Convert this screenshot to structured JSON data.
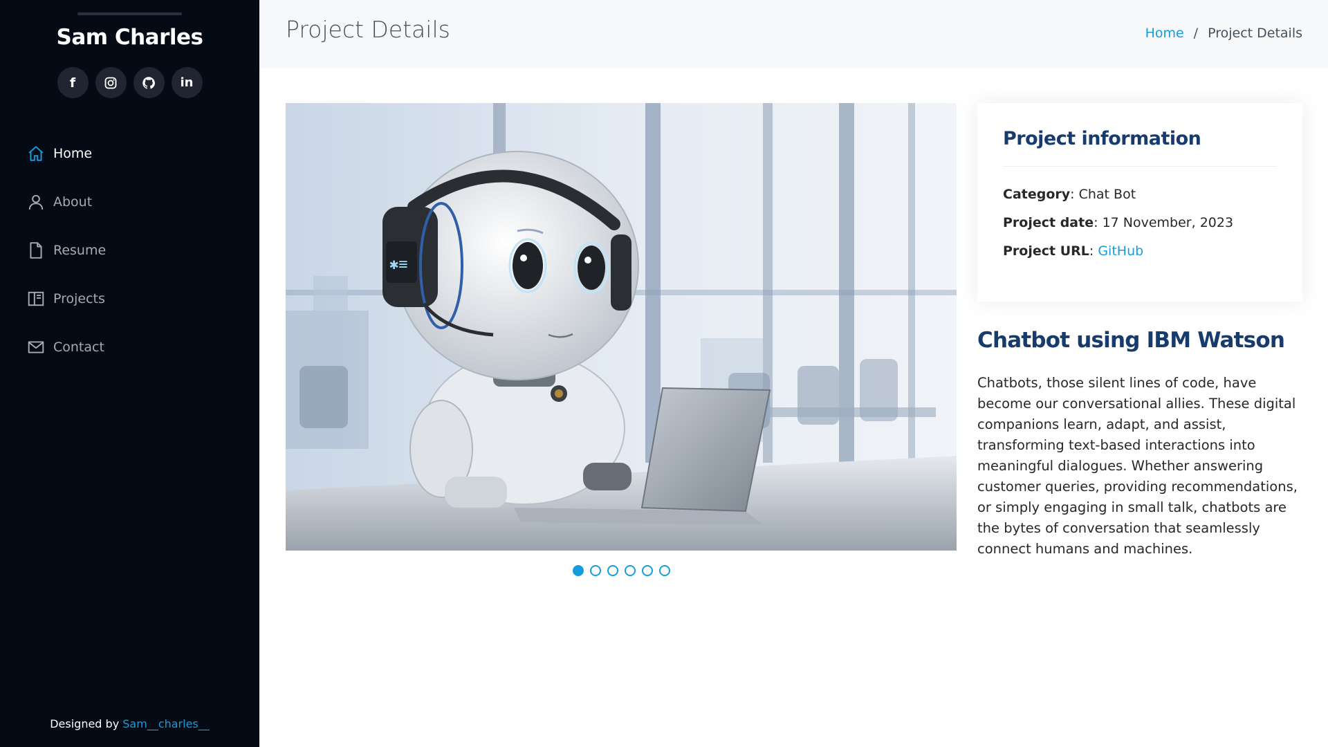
{
  "sidebar": {
    "profile_name": "Sam Charles",
    "social": [
      {
        "name": "facebook-icon",
        "glyph": "f"
      },
      {
        "name": "instagram-icon",
        "glyph": ""
      },
      {
        "name": "github-icon",
        "glyph": ""
      },
      {
        "name": "linkedin-icon",
        "glyph": "in"
      }
    ],
    "nav": [
      {
        "label": "Home",
        "icon": "home-icon",
        "active": true
      },
      {
        "label": "About",
        "icon": "person-icon",
        "active": false
      },
      {
        "label": "Resume",
        "icon": "file-icon",
        "active": false
      },
      {
        "label": "Projects",
        "icon": "book-icon",
        "active": false
      },
      {
        "label": "Contact",
        "icon": "envelope-icon",
        "active": false
      }
    ],
    "footer": {
      "prefix": "Designed by",
      "link": "Sam__charles__"
    }
  },
  "header": {
    "title": "Project Details",
    "breadcrumb": {
      "home": "Home",
      "separator": "/",
      "current": "Project Details"
    }
  },
  "gallery": {
    "image_subject": "robot-with-headset-laptop",
    "dots_count": 6,
    "active_dot": 1
  },
  "project_info": {
    "title": "Project information",
    "category_label": "Category",
    "category_value": "Chat Bot",
    "date_label": "Project date",
    "date_value": "17 November, 2023",
    "url_label": "Project URL",
    "url_value": "GitHub"
  },
  "description": {
    "title": "Chatbot using IBM Watson",
    "text": "Chatbots, those silent lines of code, have become our conversational allies. These digital companions learn, adapt, and assist, transforming text-based interactions into meaningful dialogues. Whether answering customer queries, providing recommendations, or simply engaging in small talk, chatbots are the bytes of conversation that seamlessly connect humans and machines."
  },
  "colors": {
    "accent": "#149ddd",
    "sidebar_bg": "#040b14",
    "heading": "#173b6c"
  }
}
